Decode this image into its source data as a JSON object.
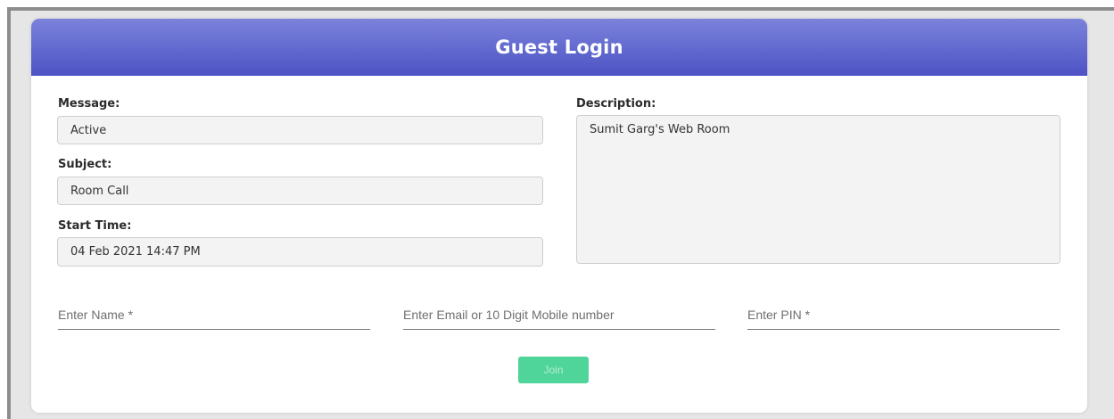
{
  "header": {
    "title": "Guest Login"
  },
  "details": {
    "message": {
      "label": "Message:",
      "value": "Active"
    },
    "subject": {
      "label": "Subject:",
      "value": "Room Call"
    },
    "start_time": {
      "label": "Start Time:",
      "value": "04 Feb 2021 14:47 PM"
    },
    "description": {
      "label": "Description:",
      "value": "Sumit Garg's Web Room"
    }
  },
  "form": {
    "name_placeholder": "Enter Name *",
    "email_placeholder": "Enter Email or 10 Digit Mobile number",
    "pin_placeholder": "Enter PIN *",
    "name_value": "",
    "email_value": "",
    "pin_value": "",
    "join_label": "Join"
  },
  "colors": {
    "header_gradient_top": "#7b82db",
    "header_gradient_bottom": "#4d52c4",
    "join_button": "#4fd49a"
  }
}
